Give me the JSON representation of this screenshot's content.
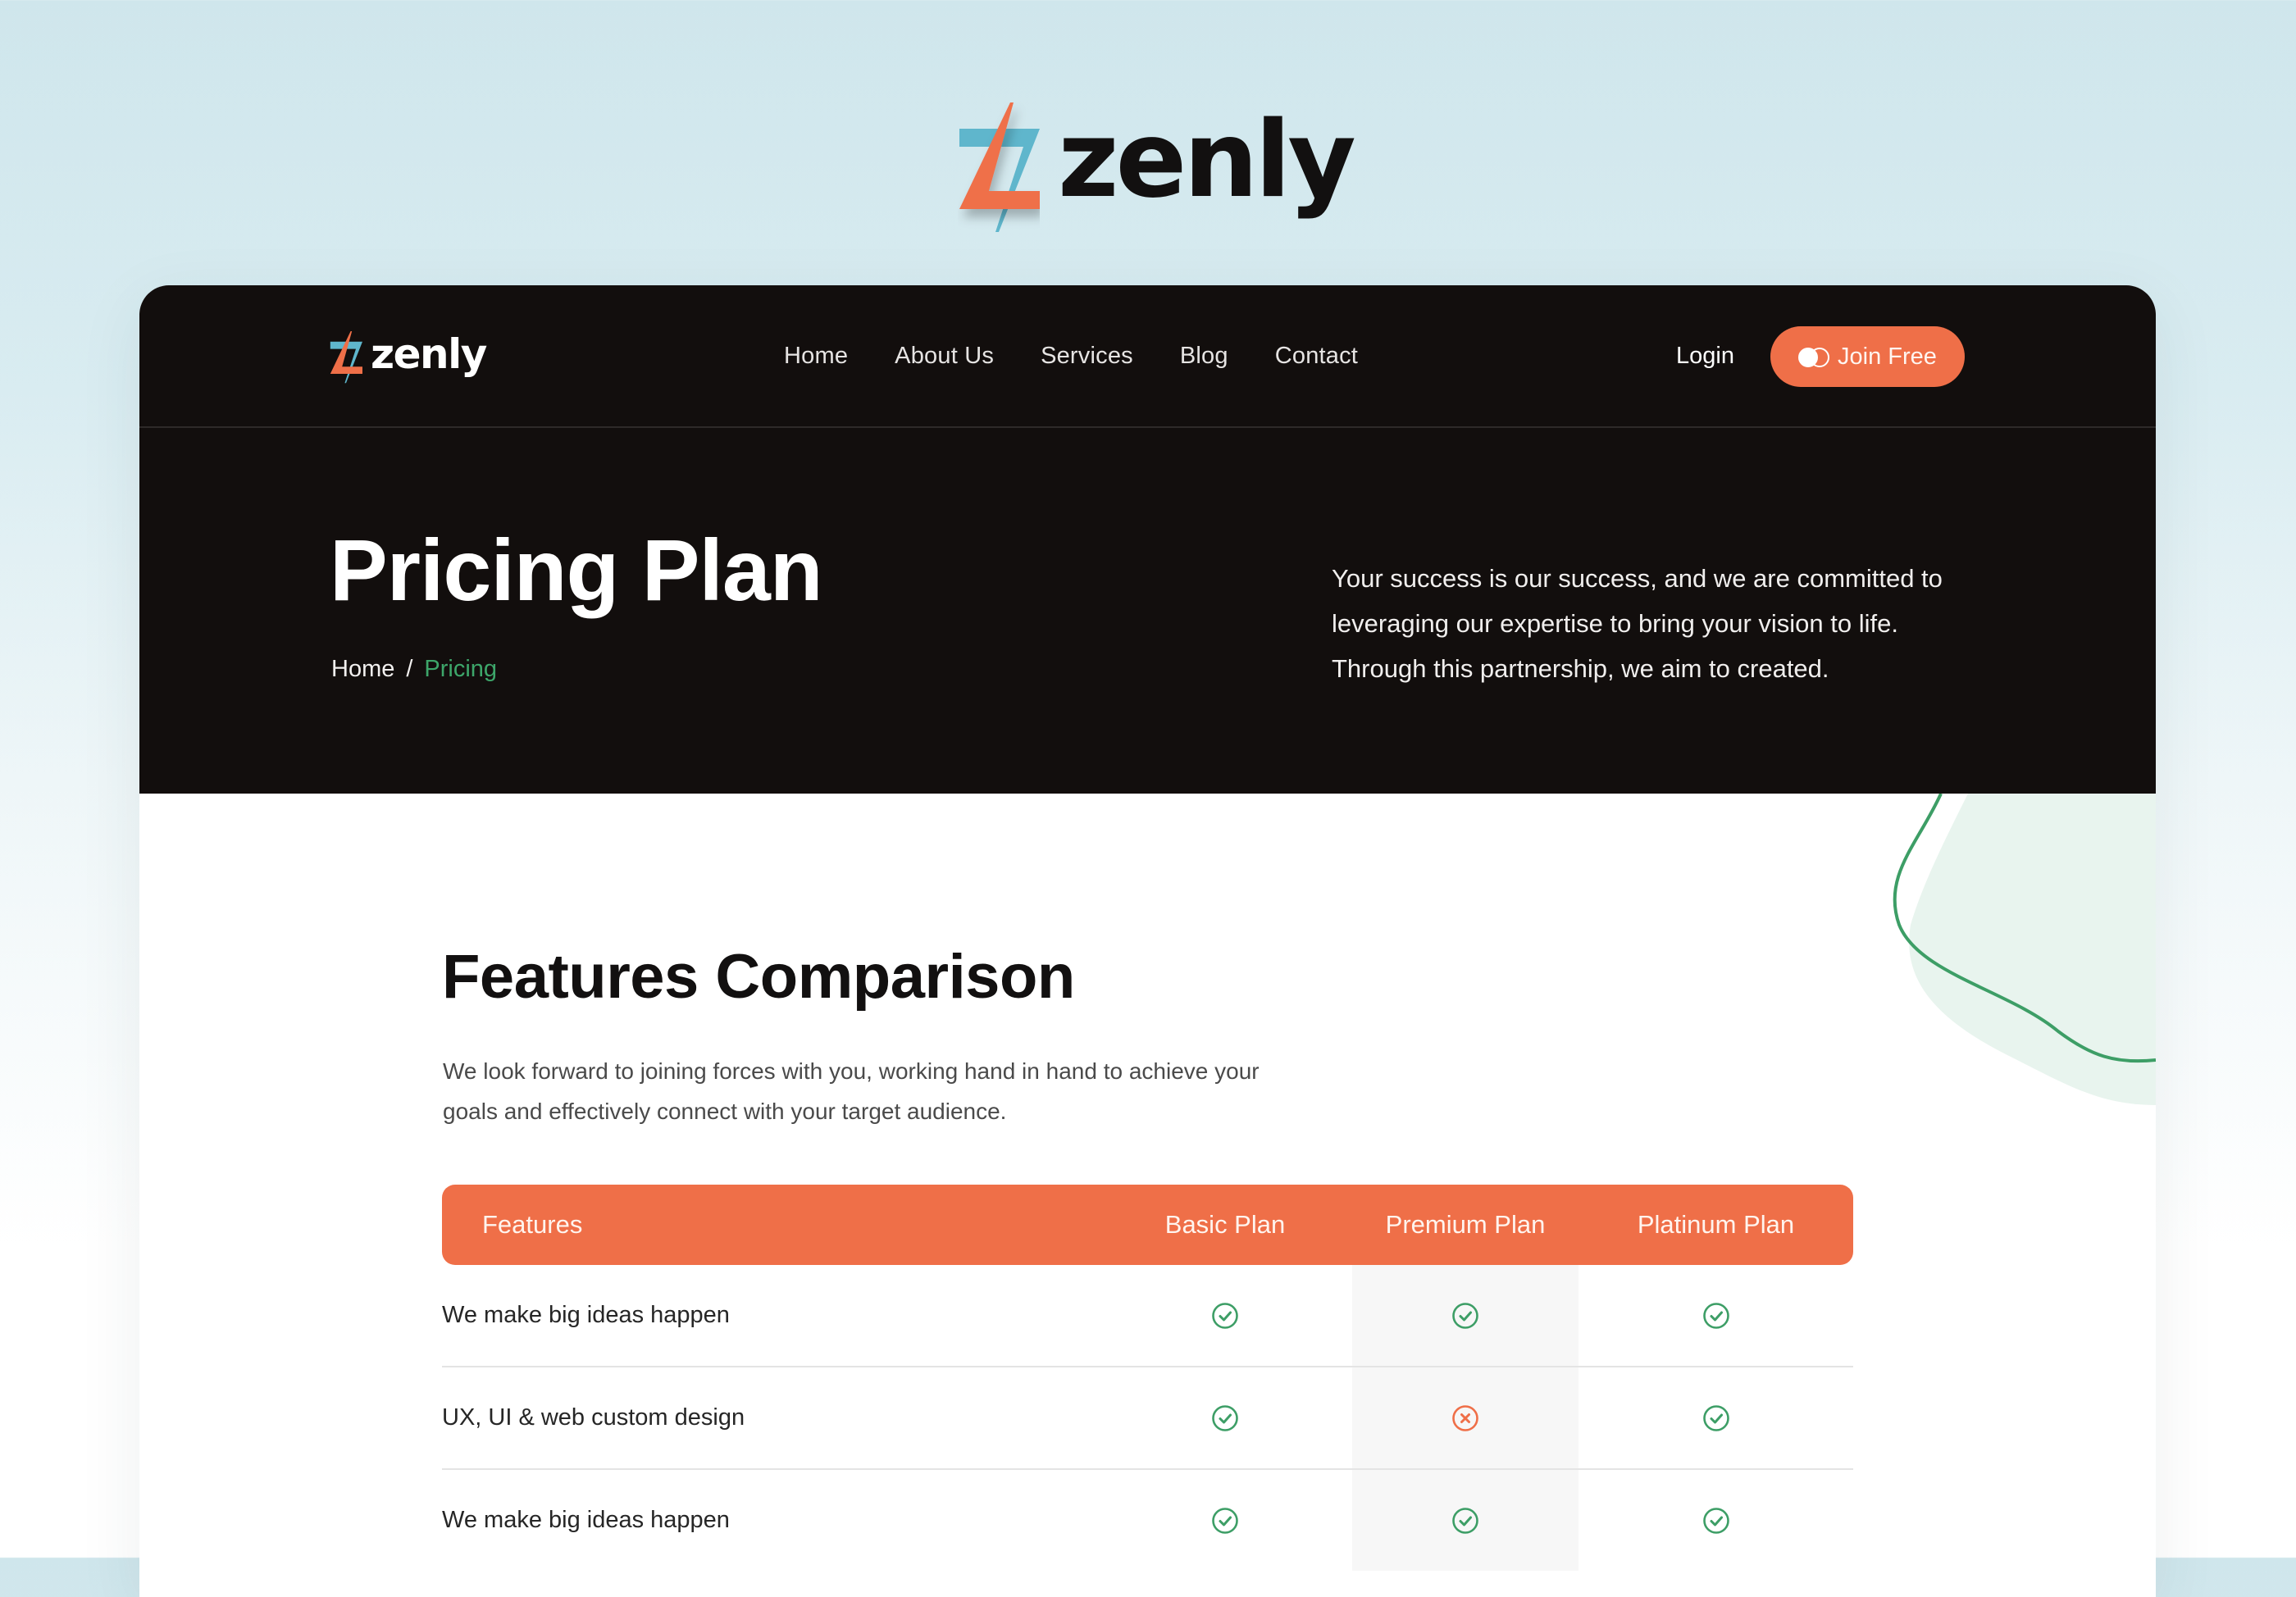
{
  "brand": {
    "name": "zenly",
    "colors": {
      "orange": "#ef6f48",
      "blue": "#5fb6cc",
      "green": "#3d9e66",
      "dark": "#120e0d"
    }
  },
  "nav": {
    "logo_text": "zenly",
    "links": [
      "Home",
      "About Us",
      "Services",
      "Blog",
      "Contact"
    ],
    "login_label": "Login",
    "join_label": "Join Free"
  },
  "hero": {
    "title": "Pricing Plan",
    "breadcrumb": {
      "home": "Home",
      "separator": "/",
      "current": "Pricing"
    },
    "description": "Your success is our success, and we are committed to leveraging our expertise to bring your vision to life. Through this partnership, we aim to created."
  },
  "features": {
    "title": "Features Comparison",
    "description": "We look forward to joining forces with you, working hand in hand to achieve your goals and effectively connect with your target audience.",
    "table": {
      "headers": [
        "Features",
        "Basic Plan",
        "Premium Plan",
        "Platinum Plan"
      ],
      "rows": [
        {
          "feature": "We make big ideas happen",
          "basic": "check",
          "premium": "check",
          "platinum": "check"
        },
        {
          "feature": "UX, UI & web custom design",
          "basic": "check",
          "premium": "cross",
          "platinum": "check"
        },
        {
          "feature": "We make big ideas happen",
          "basic": "check",
          "premium": "check",
          "platinum": "check"
        }
      ]
    }
  }
}
